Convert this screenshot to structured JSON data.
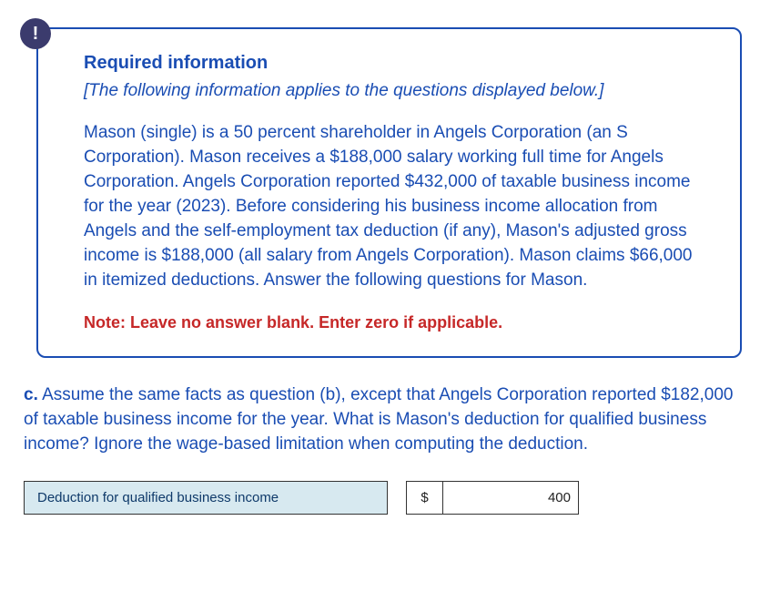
{
  "alert_symbol": "!",
  "info": {
    "heading": "Required information",
    "subtitle": "[The following information applies to the questions displayed below.]",
    "body": "Mason (single) is a 50 percent shareholder in Angels Corporation (an S Corporation). Mason receives a $188,000 salary working full time for Angels Corporation. Angels Corporation reported $432,000 of taxable business income for the year (2023). Before considering his business income allocation from Angels and the self-employment tax deduction (if any), Mason's adjusted gross income is $188,000 (all salary from Angels Corporation). Mason claims $66,000 in itemized deductions. Answer the following questions for Mason.",
    "note": "Note: Leave no answer blank. Enter zero if applicable."
  },
  "question": {
    "label": "c.",
    "text": " Assume the same facts as question (b), except that Angels Corporation reported $182,000 of taxable business income for the year. What is Mason's deduction for qualified business income? Ignore the wage-based limitation when computing the deduction."
  },
  "answer": {
    "field_label": "Deduction for qualified business income",
    "currency": "$",
    "value": "400"
  }
}
